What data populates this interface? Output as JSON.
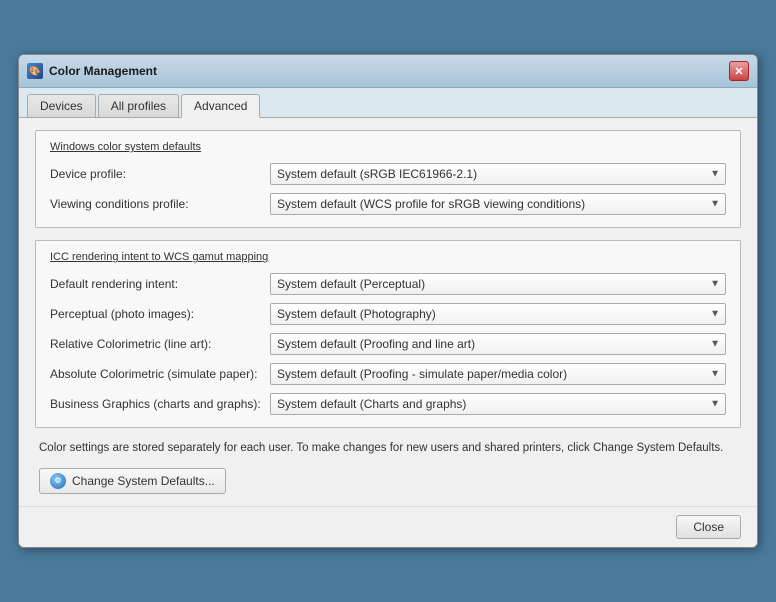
{
  "window": {
    "title": "Color Management",
    "icon": "🎨"
  },
  "tabs": [
    {
      "id": "devices",
      "label": "Devices",
      "active": false
    },
    {
      "id": "allprofiles",
      "label": "All profiles",
      "active": false
    },
    {
      "id": "advanced",
      "label": "Advanced",
      "active": true
    }
  ],
  "sections": {
    "defaults": {
      "title": "Windows color system defaults",
      "device_profile_label": "Device profile:",
      "device_profile_value": "System default (sRGB IEC61966-2.1)",
      "viewing_conditions_label": "Viewing conditions profile:",
      "viewing_conditions_value": "System default (WCS profile for sRGB viewing conditions)"
    },
    "icc": {
      "title": "ICC  rendering intent to WCS gamut mapping",
      "rows": [
        {
          "label": "Default rendering intent:",
          "value": "System default (Perceptual)"
        },
        {
          "label": "Perceptual (photo images):",
          "value": "System default (Photography)"
        },
        {
          "label": "Relative Colorimetric (line art):",
          "value": "System default (Proofing and line art)"
        },
        {
          "label": "Absolute Colorimetric (simulate paper):",
          "value": "System default (Proofing - simulate paper/media color)"
        },
        {
          "label": "Business Graphics (charts and graphs):",
          "value": "System default (Charts and graphs)"
        }
      ]
    }
  },
  "info_text": "Color settings are stored separately for each user. To make changes for new users and shared printers, click Change System Defaults.",
  "change_btn_label": "Change System Defaults...",
  "close_btn_label": "Close"
}
